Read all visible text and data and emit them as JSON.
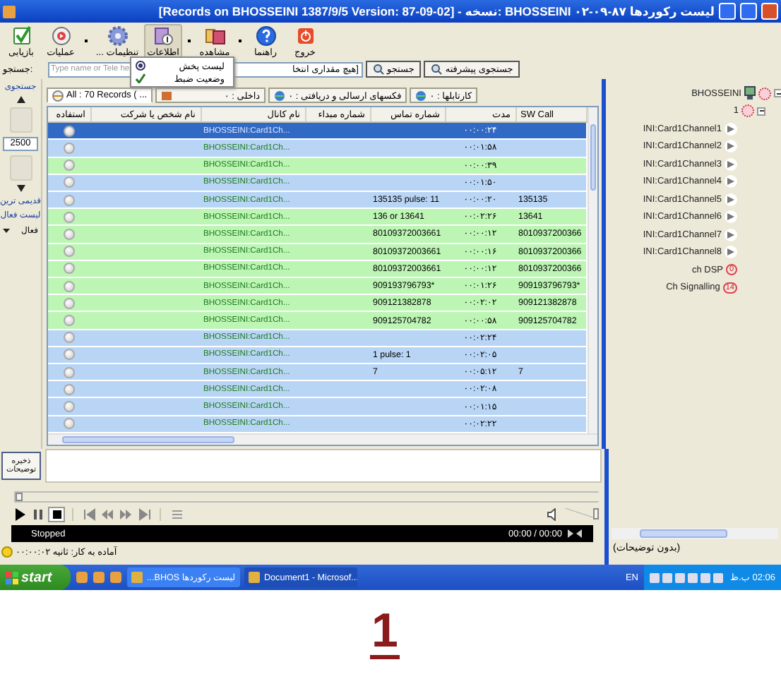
{
  "window": {
    "title": "لیست رکوردها  BHOSSEINI  ۰۲-۰۹-۸۷ :نسخه - [Records on BHOSSEINI  1387/9/5 Version: 87-09-02]"
  },
  "toolbar": [
    {
      "label": "خروج",
      "kind": "exit",
      "pressed": false,
      "dropdown": false
    },
    {
      "label": "راهنما",
      "kind": "help",
      "pressed": false,
      "dropdown": false
    },
    {
      "label": "مشاهده",
      "kind": "view",
      "pressed": false,
      "dropdown": true
    },
    {
      "label": "اطلاعات",
      "kind": "info",
      "pressed": true,
      "dropdown": true
    },
    {
      "label": "تنظیمات ...",
      "kind": "gear",
      "pressed": false,
      "dropdown": false
    },
    {
      "label": "عملیات",
      "kind": "media",
      "pressed": false,
      "dropdown": true
    },
    {
      "label": "بازیابی",
      "kind": "check",
      "pressed": false,
      "dropdown": false
    }
  ],
  "menu": [
    {
      "label": "لیست پخش",
      "kind": "radio"
    },
    {
      "label": "وضعیت ضبط",
      "kind": "check"
    }
  ],
  "search": {
    "label": "جستجو:",
    "placeholder": "Type name or Tele he",
    "filter": "[هیچ مقداری انتخا",
    "buttons": [
      "جستجوی پیشرفته",
      "جستجو"
    ]
  },
  "left_panel": {
    "top_label": "جستجوی",
    "count": "2500",
    "labels": [
      "قدیمی ترین",
      "لیست فعال"
    ],
    "dropdown": "فعال"
  },
  "tabs": [
    {
      "label": "کارتابلها : ۰",
      "selected": false
    },
    {
      "label": "فکسهای ارسالی و دریافتی : ۰",
      "selected": false
    },
    {
      "label": "داخلی : ۰",
      "selected": false
    },
    {
      "label": "All : 70 Records ( ...",
      "selected": true
    }
  ],
  "table": {
    "columns": [
      "SW Call",
      "مدت",
      "شماره تماس",
      "شماره مبداء",
      "نام کانال",
      "نام شخص یا شرکت",
      "استفاده"
    ],
    "rows": [
      {
        "channel": "BHOSSEINI:Card1Ch...",
        "duration": "۰۰:۰۰:۲۴",
        "selected": true
      },
      {
        "channel": "BHOSSEINI:Card1Ch...",
        "duration": "۰۰:۰۱:۵۸",
        "selected": false,
        "color": "#b9d5f5"
      },
      {
        "channel": "BHOSSEINI:Card1Ch...",
        "duration": "۰۰:۰۰:۳۹",
        "selected": false,
        "color": "#bcf5b4"
      },
      {
        "channel": "BHOSSEINI:Card1Ch...",
        "duration": "۰۰:۰۱:۵۰",
        "selected": false,
        "color": "#b9d5f5"
      },
      {
        "channel": "BHOSSEINI:Card1Ch...",
        "number": "135135 pulse: 11",
        "duration": "۰۰:۰۰:۲۰",
        "sw_call": "135135",
        "selected": false,
        "color": "#b9d5f5"
      },
      {
        "channel": "BHOSSEINI:Card1Ch...",
        "number": "136 or 13641",
        "duration": "۰۰:۰۲:۲۶",
        "sw_call": "13641",
        "selected": false,
        "color": "#bcf5b4"
      },
      {
        "channel": "BHOSSEINI:Card1Ch...",
        "number": "80109372003661",
        "duration": "۰۰:۰۰:۱۲",
        "sw_call": "8010937200366",
        "selected": false,
        "color": "#bcf5b4"
      },
      {
        "channel": "BHOSSEINI:Card1Ch...",
        "number": "80109372003661",
        "duration": "۰۰:۰۰:۱۶",
        "sw_call": "8010937200366",
        "selected": false,
        "color": "#bcf5b4"
      },
      {
        "channel": "BHOSSEINI:Card1Ch...",
        "number": "80109372003661",
        "duration": "۰۰:۰۰:۱۲",
        "sw_call": "8010937200366",
        "selected": false,
        "color": "#bcf5b4"
      },
      {
        "channel": "BHOSSEINI:Card1Ch...",
        "number": "909193796793*",
        "duration": "۰۰:۰۱:۲۶",
        "sw_call": "909193796793*",
        "selected": false,
        "color": "#bcf5b4"
      },
      {
        "channel": "BHOSSEINI:Card1Ch...",
        "number": "909121382878",
        "duration": "۰۰:۰۲:۰۲",
        "sw_call": "909121382878",
        "selected": false,
        "color": "#bcf5b4"
      },
      {
        "channel": "BHOSSEINI:Card1Ch...",
        "number": "909125704782",
        "duration": "۰۰:۰۰:۵۸",
        "sw_call": "909125704782",
        "selected": false,
        "color": "#bcf5b4"
      },
      {
        "channel": "BHOSSEINI:Card1Ch...",
        "duration": "۰۰:۰۲:۲۴",
        "selected": false,
        "color": "#b9d5f5"
      },
      {
        "channel": "BHOSSEINI:Card1Ch...",
        "number": "1 pulse: 1",
        "duration": "۰۰:۰۲:۰۵",
        "selected": false,
        "color": "#b9d5f5"
      },
      {
        "channel": "BHOSSEINI:Card1Ch...",
        "number": "7",
        "duration": "۰۰:۰۵:۱۲",
        "sw_call": "7",
        "selected": false,
        "color": "#b9d5f5"
      },
      {
        "channel": "BHOSSEINI:Card1Ch...",
        "duration": "۰۰:۰۲:۰۸",
        "selected": false,
        "color": "#b9d5f5"
      },
      {
        "channel": "BHOSSEINI:Card1Ch...",
        "duration": "۰۰:۰۱:۱۵",
        "selected": false,
        "color": "#b9d5f5"
      },
      {
        "channel": "BHOSSEINI:Card1Ch...",
        "duration": "۰۰:۰۲:۲۲",
        "selected": false,
        "color": "#b9d5f5"
      }
    ]
  },
  "tree": [
    {
      "label": "BHOSSEINI",
      "kind": "computer",
      "expanded": true,
      "children": [
        {
          "label": "1",
          "kind": "card",
          "expanded": true,
          "children": [
            {
              "label": "INI:Card1Channel1",
              "kind": "channel"
            },
            {
              "label": "INI:Card1Channel2",
              "kind": "channel"
            },
            {
              "label": "INI:Card1Channel3",
              "kind": "channel"
            },
            {
              "label": "INI:Card1Channel4",
              "kind": "channel"
            },
            {
              "label": "INI:Card1Channel5",
              "kind": "channel"
            },
            {
              "label": "INI:Card1Channel6",
              "kind": "channel"
            },
            {
              "label": "INI:Card1Channel7",
              "kind": "channel"
            },
            {
              "label": "INI:Card1Channel8",
              "kind": "channel"
            },
            {
              "label": "ch DSP",
              "kind": "counter",
              "badge": "0"
            },
            {
              "label": "Ch Signalling",
              "kind": "counter",
              "badge": "14"
            }
          ]
        }
      ]
    }
  ],
  "notes": {
    "save_button": "ذخیره توضیحات",
    "description": "(بدون توضیحات)"
  },
  "player": {
    "status": "Stopped",
    "time": "00:00 / 00:00",
    "seek": {
      "level": 0
    },
    "volume": {
      "level": 1
    }
  },
  "status_bar": "آماده به کار: ثانیه ۰۰:۰۰:۰۲",
  "taskbar": {
    "start": "start",
    "tasks": [
      {
        "label": "Document1 - Microsof...",
        "selected": true
      },
      {
        "label": "لیست رکوردها  BHOS...",
        "selected": false
      }
    ],
    "language": "EN",
    "clock": "02:06 ب.ظ"
  },
  "caption": "1"
}
